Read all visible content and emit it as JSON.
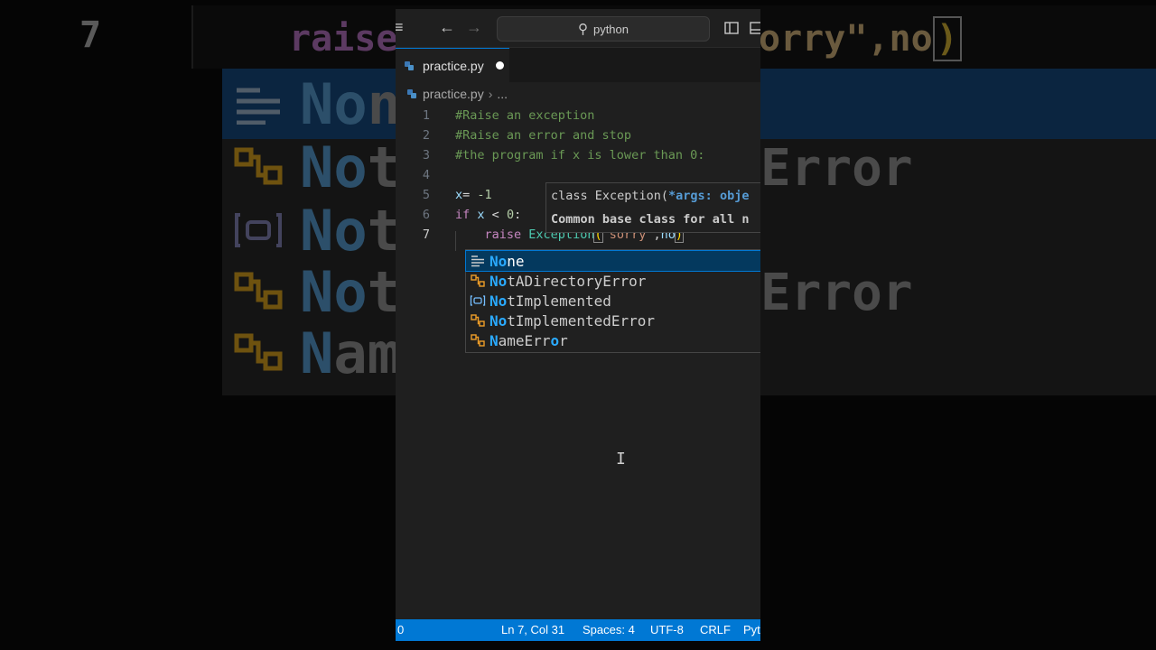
{
  "background": {
    "line_number": "7",
    "code_left": "raise",
    "code_right_text": "orry\",no",
    "code_right_paren": ")",
    "rows": [
      {
        "match": "No",
        "rest": "n"
      },
      {
        "match": "No",
        "rest": "t"
      },
      {
        "match": "No",
        "rest": "t"
      },
      {
        "match": "No",
        "rest": "t"
      },
      {
        "match": "N",
        "rest": "am"
      }
    ],
    "right_a": "Error",
    "right_b": "Error"
  },
  "titlebar": {
    "search_text": "python",
    "back_icon": "arrow-left-icon",
    "forward_icon": "arrow-right-icon"
  },
  "tab": {
    "filename": "practice.py"
  },
  "breadcrumb": {
    "file": "practice.py",
    "more": "..."
  },
  "editor": {
    "line_numbers": [
      "1",
      "2",
      "3",
      "4",
      "5",
      "6",
      "7"
    ],
    "lines": {
      "l1": "#Raise an exception",
      "l2": "#Raise an error and stop",
      "l3": "#the program if x is lower than 0:",
      "l5_var": "x",
      "l5_op": "= ",
      "l5_num": "-1",
      "l6_kw": "if",
      "l6_var": "x",
      "l6_op": " < ",
      "l6_num": "0",
      "l6_colon": ":",
      "l7_kw": "raise",
      "l7_cls": "Exception",
      "l7_open": "(",
      "l7_str": "\"sorry\"",
      "l7_comma": ",",
      "l7_typed": "no",
      "l7_close": ")"
    }
  },
  "hover": {
    "sig_prefix": "class Exception(",
    "sig_args": "*args: obje",
    "doc": "Common base class for all n"
  },
  "suggestions": [
    {
      "match": "No",
      "rest": "ne",
      "icon": "keyword-icon"
    },
    {
      "match": "No",
      "rest": "tADirectoryError",
      "icon": "class-icon"
    },
    {
      "match": "No",
      "rest": "tImplemented",
      "icon": "variable-icon"
    },
    {
      "match": "No",
      "rest": "tImplementedError",
      "icon": "class-icon"
    },
    {
      "match": "N",
      "mid": "ameErr",
      "match2": "o",
      "rest": "r",
      "icon": "class-icon"
    }
  ],
  "status": {
    "left": "0",
    "position": "Ln 7, Col 31",
    "spaces": "Spaces: 4",
    "encoding": "UTF-8",
    "eol": "CRLF",
    "language": "Pyt"
  }
}
